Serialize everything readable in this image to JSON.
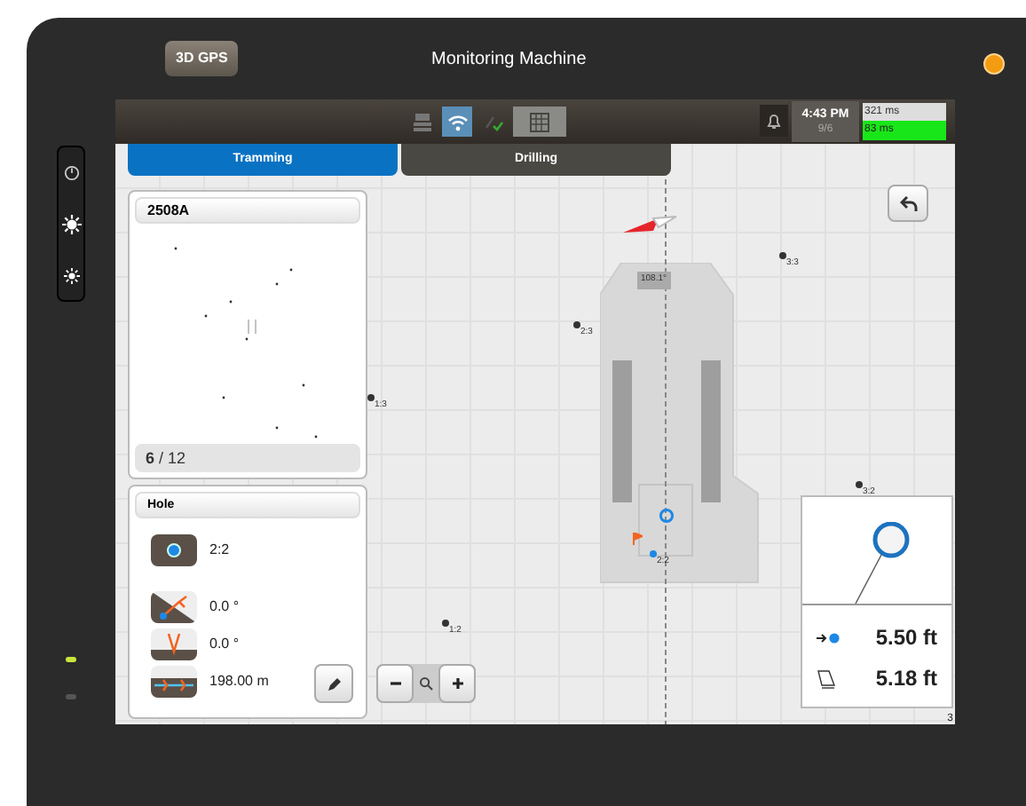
{
  "header": {
    "badge": "3D GPS",
    "title": "Monitoring Machine"
  },
  "indicator_leds": [
    {
      "on": true
    },
    {
      "on": false
    }
  ],
  "status_bar": {
    "icons": [
      {
        "kind": "machine",
        "selected": false
      },
      {
        "kind": "wifi",
        "selected": true
      },
      {
        "kind": "gps",
        "selected": false
      },
      {
        "kind": "grid",
        "selected": true
      }
    ],
    "time": "4:43 PM",
    "date": "9/6",
    "latency": [
      "321 ms",
      "83 ms"
    ]
  },
  "tabs": [
    {
      "label": "Tramming",
      "selected": true
    },
    {
      "label": "Drilling",
      "selected": false
    }
  ],
  "pattern_card": {
    "title": "2508A",
    "count": "**6** / 12"
  },
  "hole_card": {
    "title": "Hole",
    "rows": [
      {
        "kind": "hole",
        "value": "2:2"
      },
      {
        "kind": "angle",
        "value": "0.0 °"
      },
      {
        "kind": "azimuth",
        "value": "0.0 °"
      },
      {
        "kind": "depth",
        "value": "198.00 m"
      }
    ]
  },
  "map": {
    "heading": "108.1°",
    "holes": [
      {
        "label": "3:3",
        "selected": false
      },
      {
        "label": "2:3",
        "selected": false
      },
      {
        "label": "1:3",
        "selected": false
      },
      {
        "label": "3:2",
        "selected": false
      },
      {
        "label": "1:2",
        "selected": false
      },
      {
        "label": "2:2",
        "selected": true
      }
    ],
    "corner_label": "3"
  },
  "info_card": {
    "offset": "5.50 ft",
    "depth_diff": "5.18 ft"
  }
}
